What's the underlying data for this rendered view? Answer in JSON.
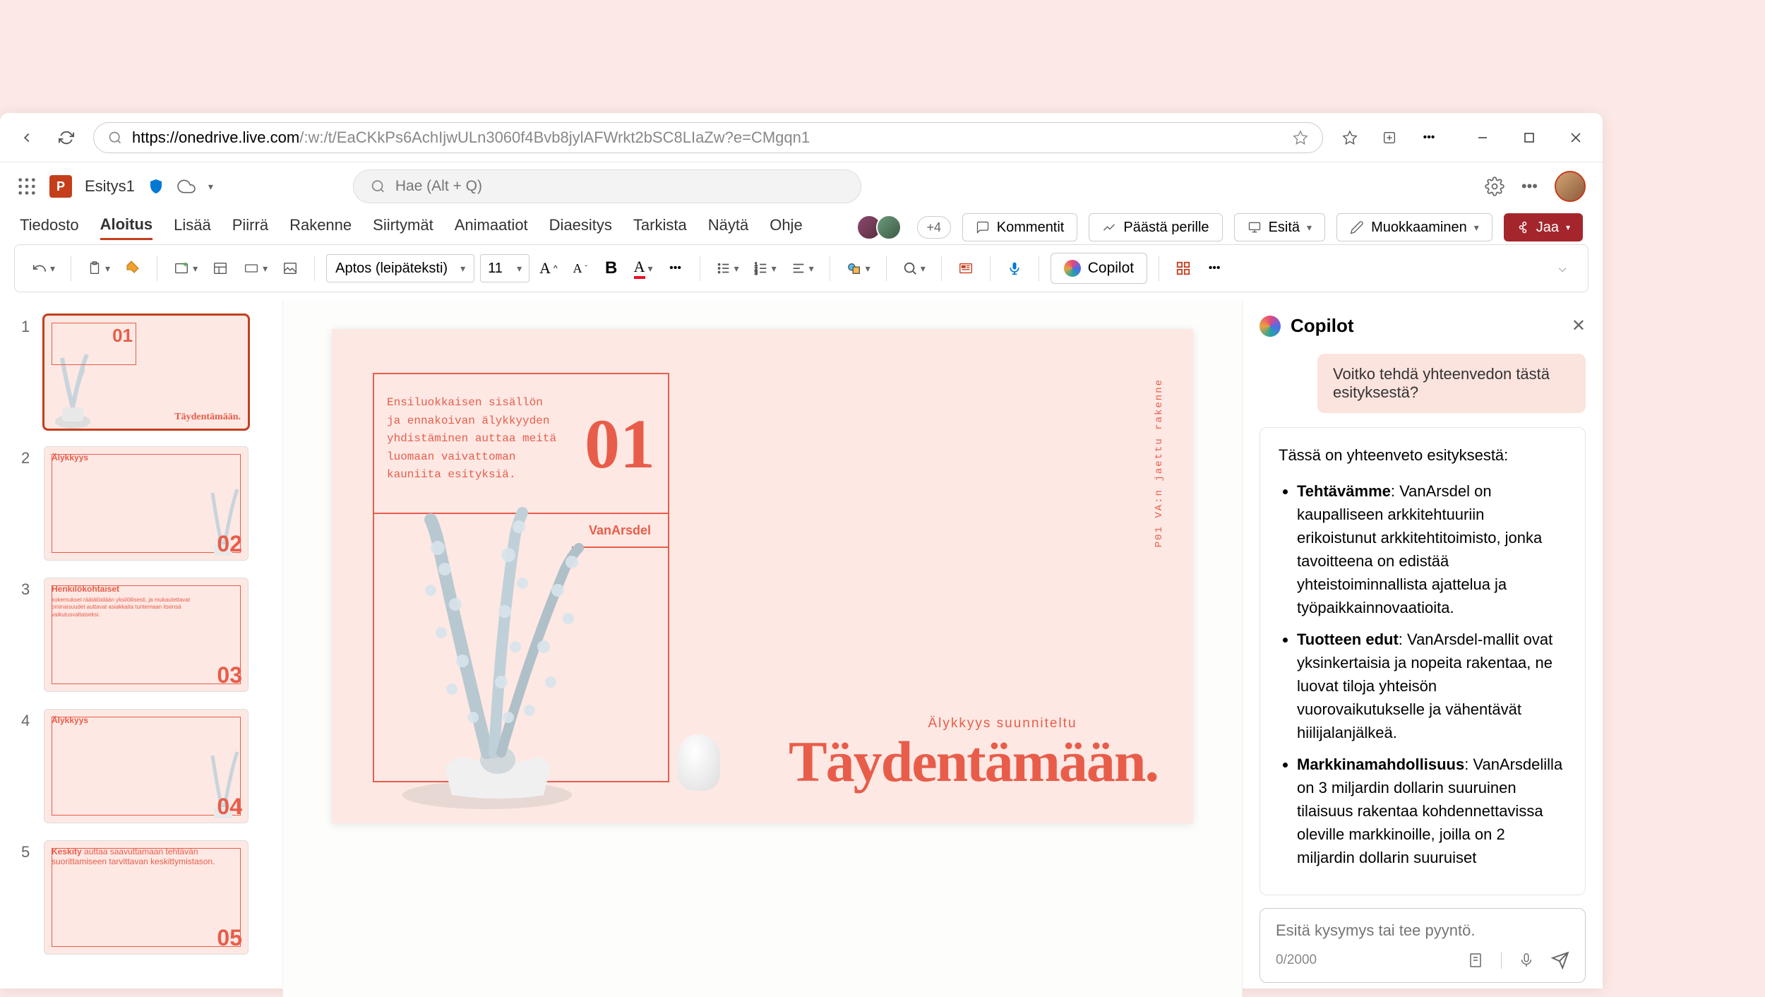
{
  "browser": {
    "url_host": "https://onedrive.live.com",
    "url_path": "/:w:/t/EaCKkPs6AchIjwULn3060f4Bvb8jylAFWrkt2bSC8LIaZw?e=CMgqn1"
  },
  "app": {
    "icon_letter": "P",
    "doc_name": "Esitys1",
    "search_placeholder": "Hae (Alt + Q)"
  },
  "tabs": {
    "file": "Tiedosto",
    "home": "Aloitus",
    "insert": "Lisää",
    "draw": "Piirrä",
    "design": "Rakenne",
    "transitions": "Siirtymät",
    "animations": "Animaatiot",
    "slideshow": "Diaesitys",
    "review": "Tarkista",
    "view": "Näytä",
    "help": "Ohje"
  },
  "presence": {
    "more": "+4"
  },
  "actions": {
    "comments": "Kommentit",
    "catchup": "Päästä perille",
    "present": "Esitä",
    "editing": "Muokkaaminen",
    "share": "Jaa"
  },
  "toolbar": {
    "font_name": "Aptos (leipäteksti)",
    "font_size": "11",
    "bold": "B",
    "copilot": "Copilot"
  },
  "thumbs": [
    {
      "n": "1",
      "big": "01",
      "title": "Täydentämään."
    },
    {
      "n": "2",
      "big": "02",
      "heading": "Älykkyys"
    },
    {
      "n": "3",
      "big": "03",
      "heading": "Henkilökohtaiset",
      "body": "kokemukset räätälöidään yksilöllisesti, ja mukautettavat ominaisuudet auttavat asiakkaita tuntemaan itsensä vaikutusvaltaiseksi."
    },
    {
      "n": "4",
      "big": "04",
      "heading": "Älykkyys"
    },
    {
      "n": "5",
      "big": "05",
      "heading": "Keskity",
      "body": "auttaa saavuttamaan tehtävän suorittamiseen tarvittavan keskittymistason."
    }
  ],
  "slide": {
    "desc": "Ensiluokkaisen sisällön ja ennakoivan älykkyyden yhdistäminen auttaa meitä luomaan vaivattoman kauniita esityksiä.",
    "number": "01",
    "brand": "VanArsdel",
    "subtitle": "Älykkyys suunniteltu",
    "title": "Täydentämään.",
    "side": "P01   VA:n jaettu rakenne"
  },
  "copilot": {
    "title": "Copilot",
    "user_msg": "Voitko tehdä yhteenvedon tästä esityksestä?",
    "intro": "Tässä on yhteenveto esityksestä:",
    "bullets": [
      {
        "b": "Tehtävämme",
        "t": ": VanArsdel on kaupalliseen arkkitehtuuriin erikoistunut arkkitehtitoimisto, jonka tavoitteena on edistää yhteistoiminnallista ajattelua ja työpaikkainnovaatioita."
      },
      {
        "b": "Tuotteen edut",
        "t": ": VanArsdel-mallit ovat yksinkertaisia ja nopeita rakentaa, ne luovat tiloja yhteisön vuorovaikutukselle ja vähentävät hiilijalanjälkeä."
      },
      {
        "b": "Markkinamahdollisuus",
        "t": ": VanArsdelilla on 3 miljardin dollarin suuruinen tilaisuus rakentaa kohdennettavissa oleville markkinoille, joilla on 2 miljardin dollarin suuruiset"
      }
    ],
    "input_placeholder": "Esitä kysymys tai tee pyyntö.",
    "counter": "0/2000"
  }
}
